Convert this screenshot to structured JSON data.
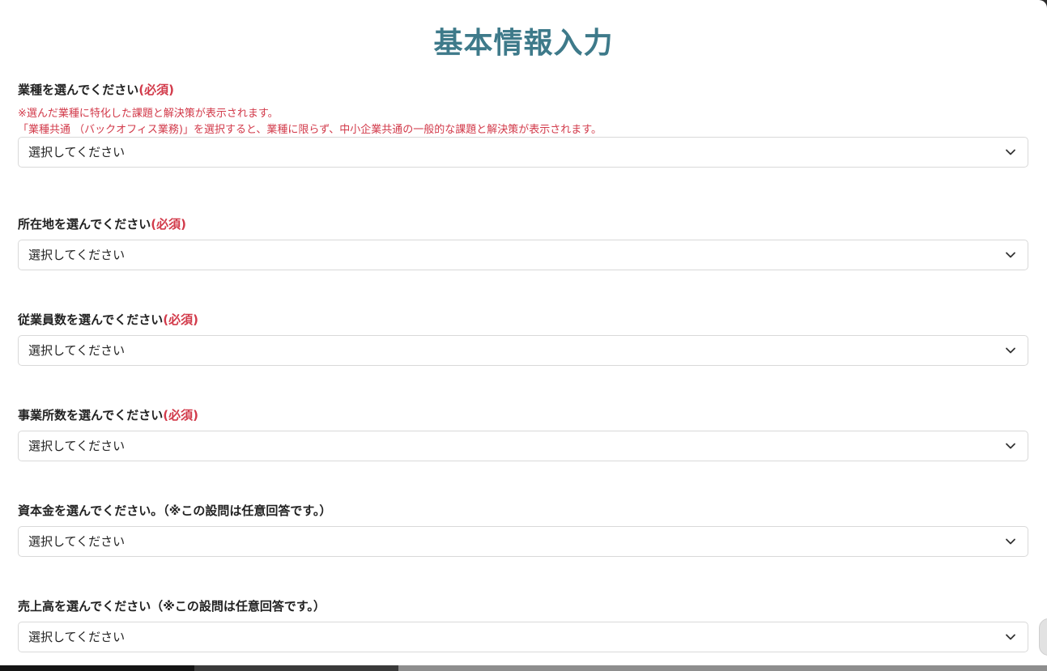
{
  "page": {
    "title": "基本情報入力"
  },
  "placeholder": "選択してください",
  "fields": [
    {
      "label": "業種を選んでください",
      "required": "(必須)",
      "notes": [
        "※選んだ業種に特化した課題と解決策が表示されます。",
        "「業種共通 （バックオフィス業務)」を選択すると、業種に限らず、中小企業共通の一般的な課題と解決策が表示されます。"
      ],
      "value": "選択してください"
    },
    {
      "label": "所在地を選んでください",
      "required": "(必須)",
      "value": "選択してください"
    },
    {
      "label": "従業員数を選んでください",
      "required": "(必須)",
      "value": "選択してください"
    },
    {
      "label": "事業所数を選んでください",
      "required": "(必須)",
      "value": "選択してください"
    },
    {
      "label": "資本金を選んでください。（※この設問は任意回答です。）",
      "value": "選択してください"
    },
    {
      "label": "売上高を選んでください（※この設問は任意回答です。）",
      "value": "選択してください"
    }
  ],
  "icons": {
    "select_arrow": "chevron-down-icon"
  },
  "colors": {
    "title": "#3e7a8a",
    "required": "#d23a4a",
    "border": "#d9d9d9"
  }
}
